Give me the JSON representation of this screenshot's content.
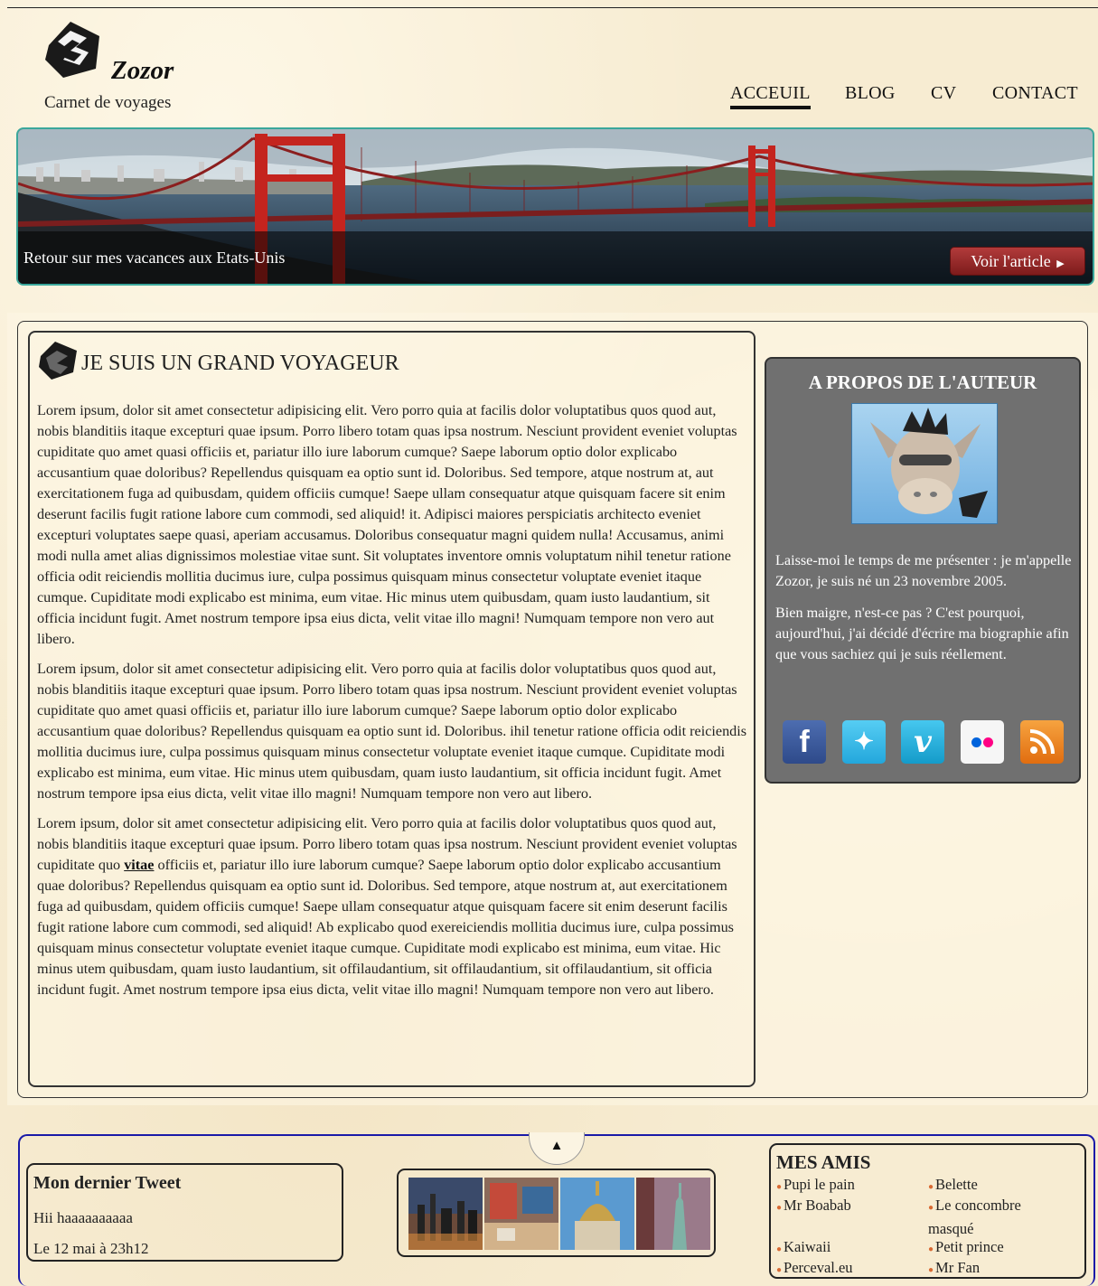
{
  "brand": {
    "name": "Zozor",
    "tagline": "Carnet de voyages"
  },
  "nav": [
    {
      "label": "ACCEUIL",
      "active": true
    },
    {
      "label": "BLOG",
      "active": false
    },
    {
      "label": "CV",
      "active": false
    },
    {
      "label": "CONTACT",
      "active": false
    }
  ],
  "banner": {
    "caption": "Retour sur mes vacances aux Etats-Unis",
    "button": "Voir l'article",
    "button_icon": "triangle-right-icon"
  },
  "article": {
    "title": "JE SUIS UN GRAND VOYAGEUR",
    "p1": "Lorem ipsum, dolor sit amet consectetur adipisicing elit. Vero porro quia at facilis dolor voluptatibus quos quod aut, nobis blanditiis itaque excepturi quae ipsum. Porro libero totam quas ipsa nostrum. Nesciunt provident eveniet voluptas cupiditate quo amet quasi officiis et, pariatur illo iure laborum cumque? Saepe laborum optio dolor explicabo accusantium quae doloribus? Repellendus quisquam ea optio sunt id. Doloribus. Sed tempore, atque nostrum at, aut exercitationem fuga ad quibusdam, quidem officiis cumque! Saepe ullam consequatur atque quisquam facere sit enim deserunt facilis fugit ratione labore cum commodi, sed aliquid! it. Adipisci maiores perspiciatis architecto eveniet excepturi voluptates saepe quasi, aperiam accusamus. Doloribus consequatur magni quidem nulla! Accusamus, animi modi nulla amet alias dignissimos molestiae vitae sunt. Sit voluptates inventore omnis voluptatum nihil tenetur ratione officia odit reiciendis mollitia ducimus iure, culpa possimus quisquam minus consectetur voluptate eveniet itaque cumque. Cupiditate modi explicabo est minima, eum vitae. Hic minus utem quibusdam, quam iusto laudantium, sit officia incidunt fugit. Amet nostrum tempore ipsa eius dicta, velit vitae illo magni! Numquam tempore non vero aut libero.",
    "p2": "Lorem ipsum, dolor sit amet consectetur adipisicing elit. Vero porro quia at facilis dolor voluptatibus quos quod aut, nobis blanditiis itaque excepturi quae ipsum. Porro libero totam quas ipsa nostrum. Nesciunt provident eveniet voluptas cupiditate quo amet quasi officiis et, pariatur illo iure laborum cumque? Saepe laborum optio dolor explicabo accusantium quae doloribus? Repellendus quisquam ea optio sunt id. Doloribus. ihil tenetur ratione officia odit reiciendis mollitia ducimus iure, culpa possimus quisquam minus consectetur voluptate eveniet itaque cumque. Cupiditate modi explicabo est minima, eum vitae. Hic minus utem quibusdam, quam iusto laudantium, sit officia incidunt fugit. Amet nostrum tempore ipsa eius dicta, velit vitae illo magni! Numquam tempore non vero aut libero.",
    "p3_before": "Lorem ipsum, dolor sit amet consectetur adipisicing elit. Vero porro quia at facilis dolor voluptatibus quos quod aut, nobis blanditiis itaque excepturi quae ipsum. Porro libero totam quas ipsa nostrum. Nesciunt provident eveniet voluptas cupiditate quo ",
    "p3_link": "vitae",
    "p3_after": " officiis et, pariatur illo iure laborum cumque? Saepe laborum optio dolor explicabo accusantium quae doloribus? Repellendus quisquam ea optio sunt id. Doloribus. Sed tempore, atque nostrum at, aut exercitationem fuga ad quibusdam, quidem officiis cumque! Saepe ullam consequatur atque quisquam facere sit enim deserunt facilis fugit ratione labore cum commodi, sed aliquid! Ab explicabo quod exereiciendis mollitia ducimus iure, culpa possimus quisquam minus consectetur voluptate eveniet itaque cumque. Cupiditate modi explicabo est minima, eum vitae. Hic minus utem quibusdam, quam iusto laudantium, sit offilaudantium, sit offilaudantium, sit offilaudantium, sit officia incidunt fugit. Amet nostrum tempore ipsa eius dicta, velit vitae illo magni! Numquam tempore non vero aut libero."
  },
  "sidebar": {
    "title": "A PROPOS DE L'AUTEUR",
    "bio1": "Laisse-moi le temps de me présenter : je m'appelle Zozor, je suis né un 23 novembre 2005.",
    "bio2": "Bien maigre, n'est-ce pas ? C'est pourquoi, aujourd'hui, j'ai décidé d'écrire ma biographie afin que vous sachiez qui je suis réellement.",
    "socials": [
      {
        "icon": "facebook-icon",
        "glyph": "f",
        "color": "#3b5998"
      },
      {
        "icon": "twitter-icon",
        "glyph": "t",
        "color": "#33b5e8"
      },
      {
        "icon": "vimeo-icon",
        "glyph": "v",
        "color": "#1ab7ea"
      },
      {
        "icon": "flickr-icon",
        "glyph": "••",
        "color": "#ffffff"
      },
      {
        "icon": "rss-icon",
        "glyph": "))",
        "color": "#f28a1f"
      }
    ]
  },
  "footer": {
    "toggle_icon": "triangle-up-icon",
    "tweet": {
      "title": "Mon dernier Tweet",
      "text": "Hii haaaaaaaaaa",
      "date": "Le 12 mai à 23h12"
    },
    "friends": {
      "title": "MES AMIS",
      "col1": [
        "Pupi le pain",
        "Mr Boabab",
        "Kaiwaii",
        "Perceval.eu"
      ],
      "col2": [
        "Belette",
        "Le concombre masqué",
        "Petit prince",
        "Mr Fan"
      ]
    }
  }
}
